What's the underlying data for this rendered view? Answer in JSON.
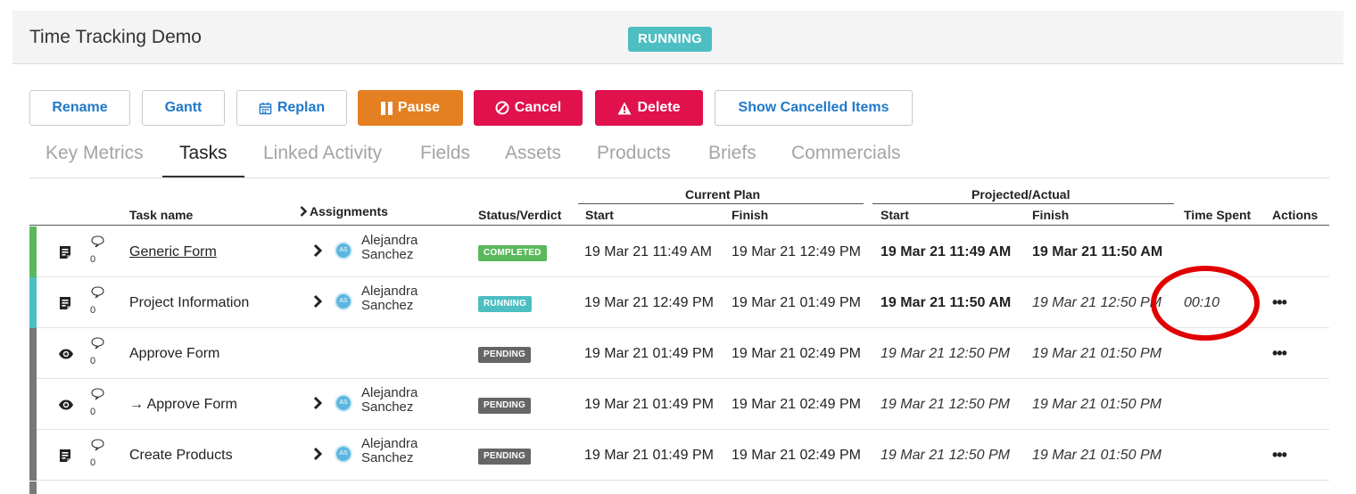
{
  "header": {
    "title": "Time Tracking Demo",
    "status": "RUNNING",
    "status_color": "#4dbec2"
  },
  "toolbar": {
    "rename": "Rename",
    "gantt": "Gantt",
    "replan": "Replan",
    "pause": "Pause",
    "cancel": "Cancel",
    "delete": "Delete",
    "show_cancelled": "Show Cancelled Items"
  },
  "tabs": [
    {
      "label": "Key Metrics",
      "active": false
    },
    {
      "label": "Tasks",
      "active": true
    },
    {
      "label": "Linked Activity",
      "active": false
    },
    {
      "label": "Fields",
      "active": false
    },
    {
      "label": "Assets",
      "active": false
    },
    {
      "label": "Products",
      "active": false
    },
    {
      "label": "Briefs",
      "active": false
    },
    {
      "label": "Commercials",
      "active": false
    }
  ],
  "table": {
    "group_headers": {
      "current_plan": "Current Plan",
      "projected_actual": "Projected/Actual"
    },
    "columns": {
      "task_name": "Task name",
      "assignments": "Assignments",
      "status": "Status/Verdict",
      "plan_start": "Start",
      "plan_finish": "Finish",
      "proj_start": "Start",
      "proj_finish": "Finish",
      "time_spent": "Time Spent",
      "actions": "Actions"
    },
    "rows": [
      {
        "bar_color": "#5cb85c",
        "icon": "form-icon",
        "comments": "0",
        "name": "Generic Form",
        "name_link": true,
        "assignee": "Alejandra\nSanchez",
        "avatar": "AS",
        "status": "COMPLETED",
        "status_color": "#5cb85c",
        "plan_start": "19 Mar 21 11:49 AM",
        "plan_finish": "19 Mar 21 12:49 PM",
        "proj_start": "19 Mar 21 11:49 AM",
        "proj_start_style": "bold",
        "proj_finish": "19 Mar 21 11:50 AM",
        "proj_finish_style": "bold",
        "time_spent": "",
        "actions": ""
      },
      {
        "bar_color": "#4dbec2",
        "icon": "form-icon",
        "comments": "0",
        "name": "Project Information",
        "name_link": false,
        "assignee": "Alejandra\nSanchez",
        "avatar": "AS",
        "status": "RUNNING",
        "status_color": "#4dbec2",
        "plan_start": "19 Mar 21 12:49 PM",
        "plan_finish": "19 Mar 21 01:49 PM",
        "proj_start": "19 Mar 21 11:50 AM",
        "proj_start_style": "bold",
        "proj_finish": "19 Mar 21 12:50 PM",
        "proj_finish_style": "italic",
        "time_spent": "00:10",
        "actions": "•••"
      },
      {
        "bar_color": "#777777",
        "icon": "eye-icon",
        "comments": "0",
        "name": "Approve Form",
        "name_link": false,
        "assignee": "",
        "avatar": "",
        "status": "PENDING",
        "status_color": "#666666",
        "plan_start": "19 Mar 21 01:49 PM",
        "plan_finish": "19 Mar 21 02:49 PM",
        "proj_start": "19 Mar 21 12:50 PM",
        "proj_start_style": "italic",
        "proj_finish": "19 Mar 21 01:50 PM",
        "proj_finish_style": "italic",
        "time_spent": "",
        "actions": "•••"
      },
      {
        "bar_color": "#777777",
        "icon": "eye-icon",
        "comments": "0",
        "name": "→ Approve Form",
        "name_link": false,
        "assignee": "Alejandra\nSanchez",
        "avatar": "AS",
        "status": "PENDING",
        "status_color": "#666666",
        "plan_start": "19 Mar 21 01:49 PM",
        "plan_finish": "19 Mar 21 02:49 PM",
        "proj_start": "19 Mar 21 12:50 PM",
        "proj_start_style": "italic",
        "proj_finish": "19 Mar 21 01:50 PM",
        "proj_finish_style": "italic",
        "time_spent": "",
        "actions": ""
      },
      {
        "bar_color": "#777777",
        "icon": "form-icon",
        "comments": "0",
        "name": "Create Products",
        "name_link": false,
        "assignee": "Alejandra\nSanchez",
        "avatar": "AS",
        "status": "PENDING",
        "status_color": "#666666",
        "plan_start": "19 Mar 21 01:49 PM",
        "plan_finish": "19 Mar 21 02:49 PM",
        "proj_start": "19 Mar 21 12:50 PM",
        "proj_start_style": "italic",
        "proj_finish": "19 Mar 21 01:50 PM",
        "proj_finish_style": "italic",
        "time_spent": "",
        "actions": "•••"
      }
    ]
  },
  "annotation": {
    "shape": "circle",
    "color": "#e10000",
    "target": "time_spent"
  }
}
